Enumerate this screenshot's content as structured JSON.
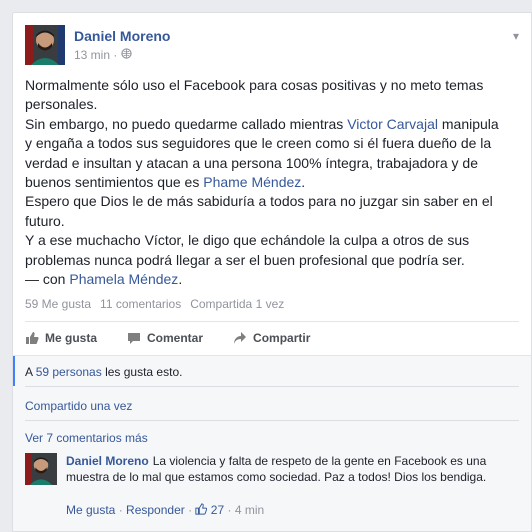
{
  "post": {
    "author": "Daniel Moreno",
    "time": "13 min ·",
    "chevron": "▾",
    "body": [
      [
        "Normalmente sólo uso el Facebook para cosas positivas y no meto temas"
      ],
      [
        "personales."
      ],
      [
        "Sin embargo, no puedo quedarme callado mientras ",
        {
          "t": "Victor Carvajal",
          "link": true
        },
        " manipula"
      ],
      [
        "y engaña a todos sus seguidores que le creen como si él fuera dueño de la"
      ],
      [
        "verdad e insultan y atacan a una persona 100% íntegra, trabajadora y de"
      ],
      [
        "buenos sentimientos que es ",
        {
          "t": "Phame Méndez",
          "link": true
        },
        "."
      ],
      [
        "Espero que Dios le de más sabiduría a todos para no juzgar sin saber en el"
      ],
      [
        "futuro."
      ],
      [
        "Y a ese muchacho Víctor, le digo que echándole la culpa a otros de sus"
      ],
      [
        "problemas nunca podrá llegar a ser el buen profesional que podría ser."
      ],
      [
        "— con ",
        {
          "t": "Phamela Méndez",
          "link": true
        },
        "."
      ]
    ],
    "stats": {
      "likes": "59 Me gusta",
      "comments": "11 comentarios",
      "shares": "Compartida 1 vez"
    },
    "actions": {
      "like": "Me gusta",
      "comment": "Comentar",
      "share": "Compartir"
    }
  },
  "feedback": {
    "likes_prefix": "A ",
    "likes_link": "59 personas",
    "likes_suffix": " les gusta esto.",
    "shared": "Compartido una vez",
    "more_comments": "Ver 7 comentarios más"
  },
  "comment": {
    "author": "Daniel Moreno",
    "text": "La violencia y falta de respeto de la gente en Facebook es una muestra de lo mal que estamos como sociedad. Paz a todos! Dios los bendiga.",
    "like": "Me gusta",
    "reply": "Responder",
    "like_count": "27",
    "time": "4 min"
  },
  "colors": {
    "link": "#365899",
    "accent": "#4080ff"
  }
}
